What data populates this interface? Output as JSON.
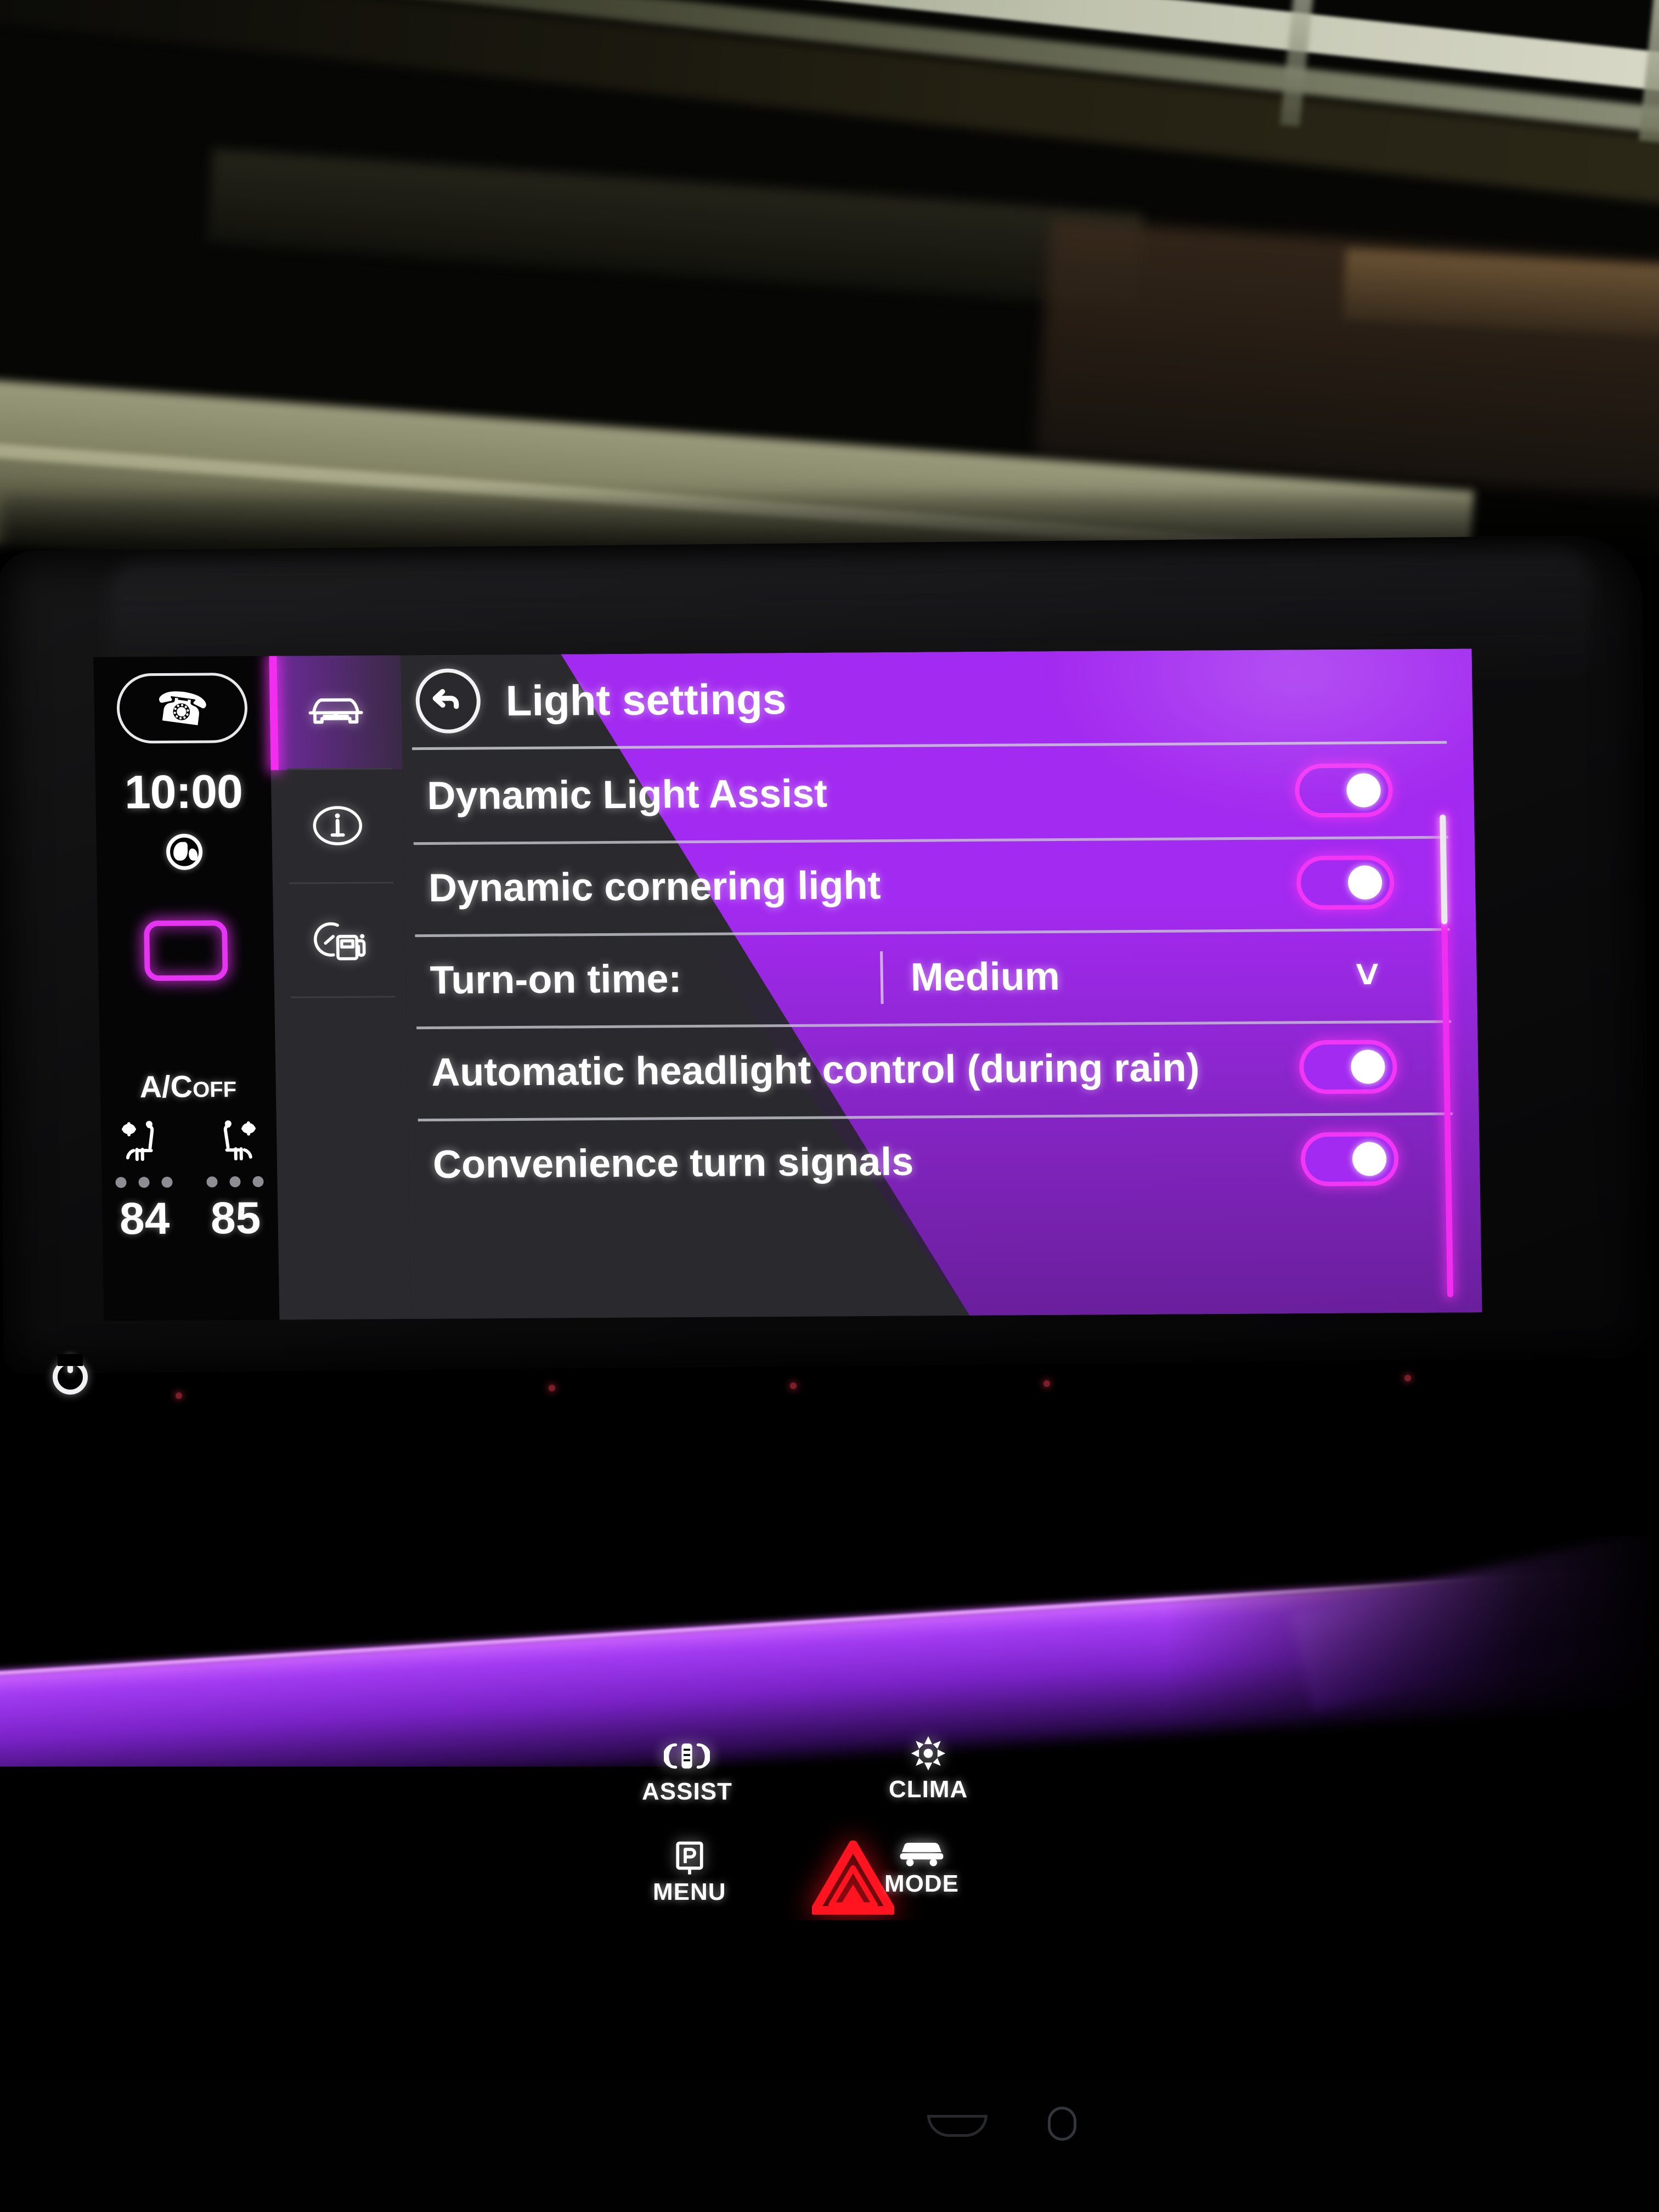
{
  "device": {
    "kind": "car-infotainment-screen",
    "accent_purple": "#A32AF0",
    "accent_purple_dark": "#6B2C9E",
    "accent_magenta": "#F12EF0",
    "panel_dark": "#2A2A2E"
  },
  "sidebar": {
    "phone_button": {
      "icon": "phone-handset-icon"
    },
    "clock": "10:00",
    "globe": {
      "icon": "globe-icon"
    },
    "ambient_light_box": {
      "icon": "ambient-light-swatch",
      "color": "#E535F2"
    },
    "ac_status": {
      "prefix": "A/C",
      "suffix": "OFF"
    },
    "seats": [
      {
        "name": "driver-seat-climate",
        "icon": "seat-ventilation-icon",
        "level_dots": 3,
        "active_dots": 0,
        "temperature": "84"
      },
      {
        "name": "passenger-seat-climate",
        "icon": "seat-ventilation-icon",
        "level_dots": 3,
        "active_dots": 0,
        "temperature": "85"
      }
    ]
  },
  "icon_nav": [
    {
      "name": "vehicle",
      "icon": "car-front-icon",
      "active": true
    },
    {
      "name": "info",
      "icon": "info-circle-icon",
      "active": false
    },
    {
      "name": "consumption",
      "icon": "fuel-gauge-icon",
      "active": false
    }
  ],
  "header": {
    "back_button": {
      "icon": "back-arrow-icon"
    },
    "title": "Light settings"
  },
  "settings_rows": [
    {
      "label": "Dynamic Light Assist",
      "control": "toggle",
      "value": "on"
    },
    {
      "label": "Dynamic cornering light",
      "control": "toggle",
      "value": "on"
    },
    {
      "label": "Turn-on time:",
      "control": "dropdown",
      "value": "Medium",
      "chevron": "chevron-down-icon"
    },
    {
      "label": "Automatic headlight control (during rain)",
      "control": "toggle",
      "value": "on"
    },
    {
      "label": "Convenience turn signals",
      "control": "toggle",
      "value": "on"
    }
  ],
  "scrollbar": {
    "position": "top",
    "thumb_fraction": 0.23
  },
  "console": {
    "power_button": {
      "icon": "power-icon"
    },
    "hardware_buttons": [
      {
        "label": "ASSIST",
        "icon": "assist-icon"
      },
      {
        "label": "CLIMA",
        "icon": "fan-snowflake-icon"
      },
      {
        "label": "MENU",
        "icon": "park-p-icon"
      },
      {
        "label": "MODE",
        "icon": "car-side-icon"
      },
      {
        "label": "",
        "icon": "hazard-triangle-icon",
        "color": "#FF1420"
      }
    ]
  },
  "ambient_strip": {
    "color": "#A33BF2",
    "description": "purple dashboard ambient light"
  }
}
